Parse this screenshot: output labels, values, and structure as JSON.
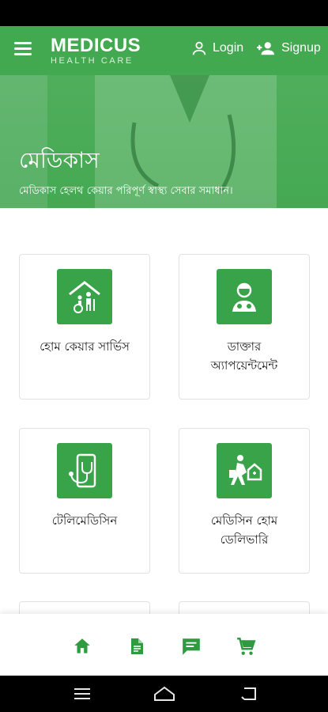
{
  "header": {
    "brand_name": "MEDICUS",
    "brand_subtitle": "HEALTH CARE",
    "login_label": "Login",
    "signup_label": "Signup",
    "background_color": "#43a950"
  },
  "hero": {
    "title": "মেডিকাস",
    "subtitle": "মেডিকাস হেলথ কেয়ার পরিপূর্ণ স্বাস্থ্য সেবার সমাধান।"
  },
  "services": [
    {
      "label_line1": "হোম কেয়ার সার্ভিস",
      "label_line2": "",
      "icon": "home-care-icon"
    },
    {
      "label_line1": "ডাক্তার",
      "label_line2": "অ্যাপয়েন্টমেন্ট",
      "icon": "doctor-icon"
    },
    {
      "label_line1": "টেলিমেডিসিন",
      "label_line2": "",
      "icon": "telemedicine-icon"
    },
    {
      "label_line1": "মেডিসিন হোম",
      "label_line2": "ডেলিভারি",
      "icon": "medicine-delivery-icon"
    }
  ],
  "bottom_nav": {
    "items": [
      "home-icon",
      "document-icon",
      "chat-icon",
      "cart-icon"
    ],
    "accent_color": "#2e9b40"
  },
  "system_nav": [
    "recents-icon",
    "home-nav-icon",
    "back-icon"
  ]
}
